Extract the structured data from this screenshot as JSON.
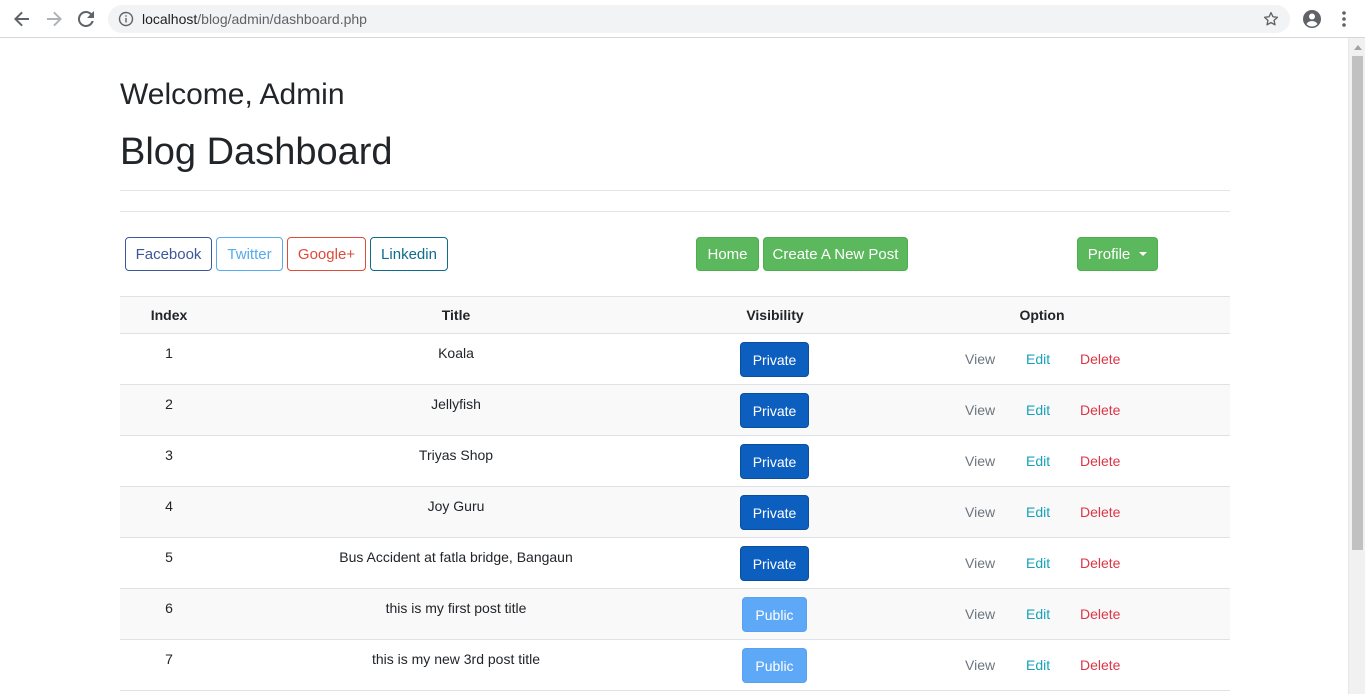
{
  "browser": {
    "url_host": "localhost",
    "url_path": "/blog/admin/dashboard.php"
  },
  "page": {
    "welcome": "Welcome, Admin",
    "title": "Blog Dashboard"
  },
  "social": {
    "facebook": "Facebook",
    "twitter": "Twitter",
    "googleplus": "Google+",
    "linkedin": "Linkedin"
  },
  "nav": {
    "home": "Home",
    "create": "Create A New Post",
    "profile": "Profile"
  },
  "table": {
    "headers": {
      "index": "Index",
      "title": "Title",
      "visibility": "Visibility",
      "option": "Option"
    },
    "option_labels": {
      "view": "View",
      "edit": "Edit",
      "delete": "Delete"
    },
    "rows": [
      {
        "index": "1",
        "title": "Koala",
        "visibility": "Private"
      },
      {
        "index": "2",
        "title": "Jellyfish",
        "visibility": "Private"
      },
      {
        "index": "3",
        "title": "Triyas Shop",
        "visibility": "Private"
      },
      {
        "index": "4",
        "title": "Joy Guru",
        "visibility": "Private"
      },
      {
        "index": "5",
        "title": "Bus Accident at fatla bridge, Bangaun",
        "visibility": "Private"
      },
      {
        "index": "6",
        "title": "this is my first post title",
        "visibility": "Public"
      },
      {
        "index": "7",
        "title": "this is my new 3rd post title",
        "visibility": "Public"
      }
    ]
  },
  "colors": {
    "private": "#0d5fbf",
    "public": "#5ea9f7",
    "success": "#5cb85c"
  }
}
